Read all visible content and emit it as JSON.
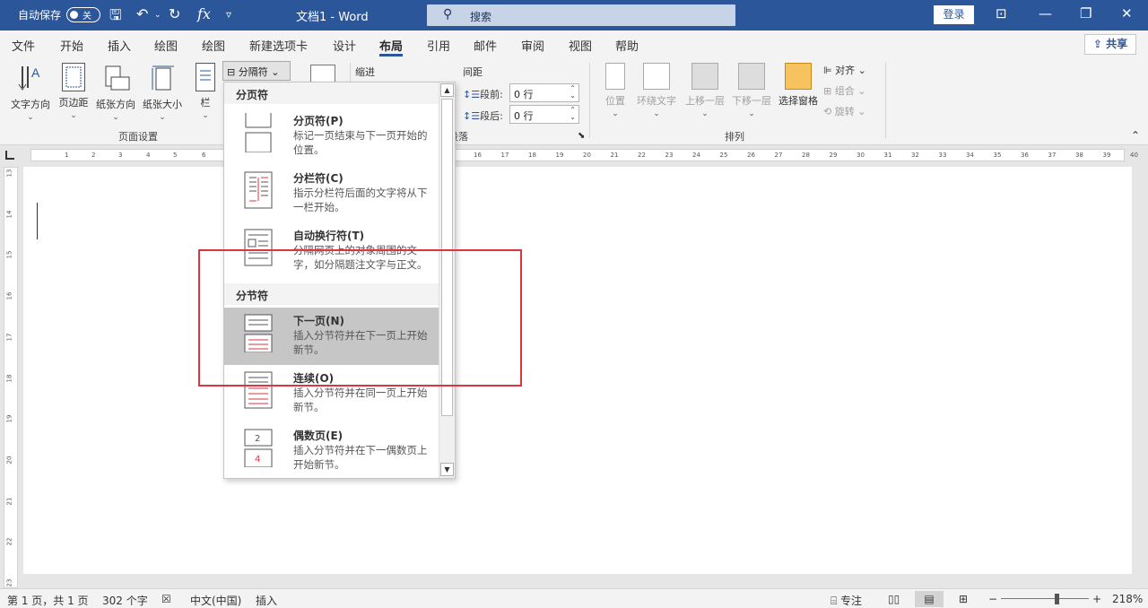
{
  "titlebar": {
    "autosave_label": "自动保存",
    "autosave_state": "关",
    "doc_title": "文档1  -  Word",
    "search_placeholder": "搜索",
    "login_label": "登录",
    "minimize": "—",
    "restore": "❐",
    "close": "✕",
    "save_icon": "🖫",
    "undo_icon": "↶",
    "redo_icon": "↻",
    "fx_icon": "fx",
    "qat_more": "▿"
  },
  "tabs": [
    "文件",
    "开始",
    "插入",
    "绘图",
    "绘图",
    "新建选项卡",
    "设计",
    "布局",
    "引用",
    "邮件",
    "审阅",
    "视图",
    "帮助"
  ],
  "active_tab": "布局",
  "share_label": "共享",
  "ribbon": {
    "page_setup": {
      "buttons": [
        "文字方向",
        "页边距",
        "纸张方向",
        "纸张大小",
        "栏"
      ],
      "group_label": "页面设置",
      "breaks_label": "分隔符"
    },
    "paragraph": {
      "indent_label": "缩进",
      "spacing_label": "间距",
      "before_label": "段前:",
      "before_value": "0 行",
      "after_label": "段后:",
      "after_value": "0 行",
      "group_label": "段落"
    },
    "arrange": {
      "position": "位置",
      "wrap_text": "环绕文字",
      "bring_forward": "上移一层",
      "send_backward": "下移一层",
      "selection_pane": "选择窗格",
      "align": "对齐",
      "group": "组合",
      "rotate": "旋转",
      "group_label": "排列"
    }
  },
  "ruler": {
    "h_labels": [
      "1",
      "2",
      "3",
      "4",
      "5",
      "6",
      "16",
      "17",
      "18",
      "19",
      "20",
      "21",
      "22",
      "23",
      "24",
      "25",
      "26",
      "27",
      "28",
      "29",
      "30",
      "31",
      "32",
      "33",
      "34",
      "35",
      "36",
      "37",
      "38",
      "39",
      "40"
    ],
    "v_labels": [
      "13",
      "14",
      "15",
      "16",
      "17",
      "18",
      "19",
      "20",
      "21",
      "22",
      "23"
    ]
  },
  "dropdown": {
    "section_page": "分页符",
    "section_section": "分节符",
    "items": [
      {
        "title": "分页符(P)",
        "desc": "标记一页结束与下一页开始的位置。"
      },
      {
        "title": "分栏符(C)",
        "desc": "指示分栏符后面的文字将从下一栏开始。"
      },
      {
        "title": "自动换行符(T)",
        "desc": "分隔网页上的对象周围的文字，如分隔题注文字与正文。"
      },
      {
        "title": "下一页(N)",
        "desc": "插入分节符并在下一页上开始新节。"
      },
      {
        "title": "连续(O)",
        "desc": "插入分节符并在同一页上开始新节。"
      },
      {
        "title": "偶数页(E)",
        "desc": "插入分节符并在下一偶数页上开始新节。"
      }
    ]
  },
  "status": {
    "page_info": "第 1 页，共 1 页",
    "word_count": "302 个字",
    "language": "中文(中国)",
    "mode": "插入",
    "focus": "专注",
    "zoom": "218%",
    "zoom_minus": "−",
    "zoom_plus": "+"
  },
  "colors": {
    "title_blue": "#2b579a",
    "highlight_red": "#d9363e",
    "selected_gray": "#c6c6c6"
  }
}
